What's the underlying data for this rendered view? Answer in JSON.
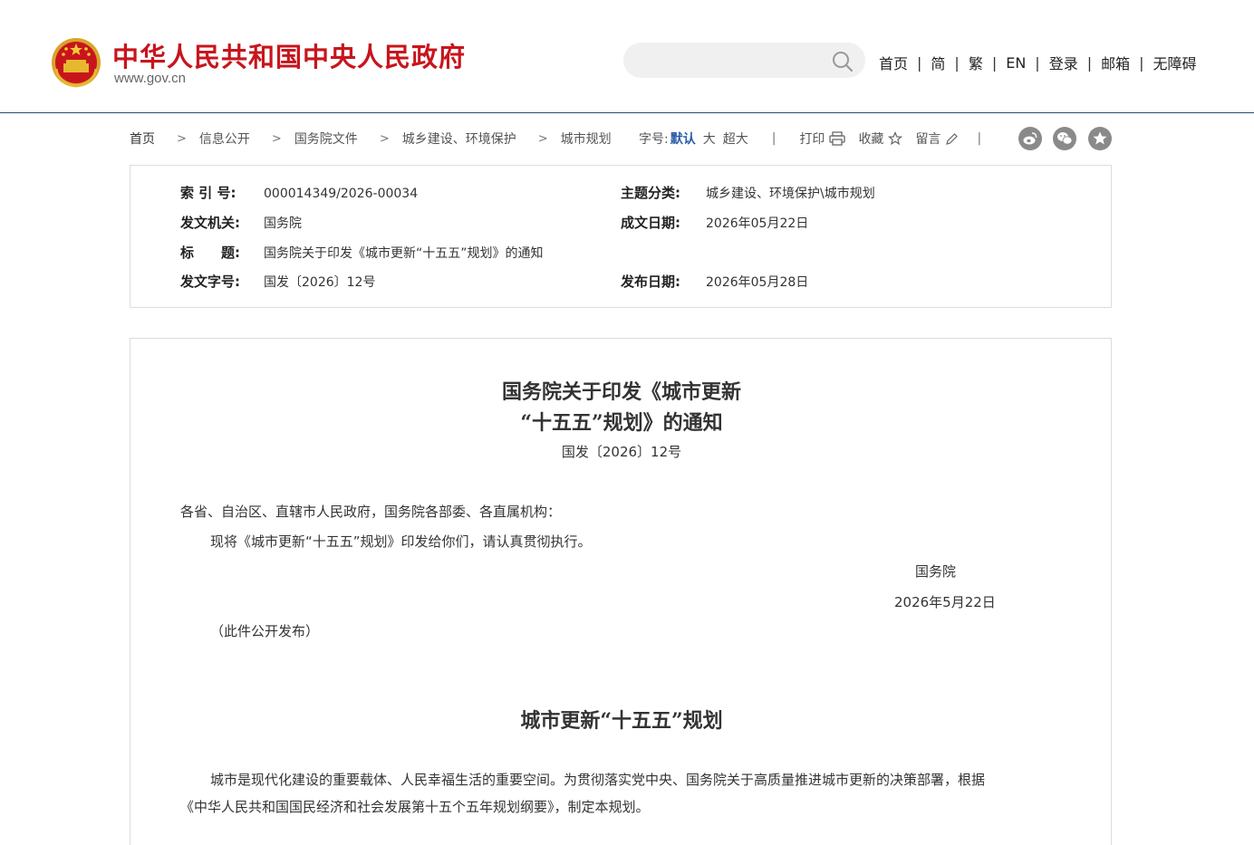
{
  "header": {
    "site_title": "中华人民共和国中央人民政府",
    "site_url": "www.gov.cn",
    "search": {
      "value": "",
      "placeholder": ""
    },
    "nav": [
      "首页",
      "简",
      "繁",
      "EN",
      "登录",
      "邮箱",
      "无障碍"
    ],
    "colors": {
      "brand_red": "#c8151d",
      "divider": "#2b4a6e"
    }
  },
  "breadcrumb": [
    "首页",
    "信息公开",
    "国务院文件",
    "城乡建设、环境保护",
    "城市规划"
  ],
  "tools": {
    "font_size_label": "字号:",
    "font_sizes": [
      "默认",
      "大",
      "超大"
    ],
    "print": "打印",
    "favorite": "收藏",
    "comment": "留言",
    "share_icons": [
      "weibo-icon",
      "wechat-icon",
      "star-icon"
    ]
  },
  "info": {
    "index_label": "索 引 号:",
    "index_value": "000014349/2026-00034",
    "topic_label": "主题分类:",
    "topic_value": "城乡建设、环境保护\\城市规划",
    "issuer_label": "发文机关:",
    "issuer_value": "国务院",
    "written_label": "成文日期:",
    "written_value": "2026年05月22日",
    "title_label": "标　　题:",
    "title_value": "国务院关于印发《城市更新“十五五”规划》的通知",
    "docno_label": "发文字号:",
    "docno_value": "国发〔2026〕12号",
    "published_label": "发布日期:",
    "published_value": "2026年05月28日"
  },
  "article": {
    "title_line1": "国务院关于印发《城市更新",
    "title_line2": "“十五五”规划》的通知",
    "docno": "国发〔2026〕12号",
    "addressee": "各省、自治区、直辖市人民政府，国务院各部委、各直属机构：",
    "body": "现将《城市更新“十五五”规划》印发给你们，请认真贯彻执行。",
    "signature": "国务院",
    "date": "2026年5月22日",
    "note": "（此件公开发布）",
    "subtitle": "城市更新“十五五”规划",
    "intro_line1": "城市是现代化建设的重要载体、人民幸福生活的重要空间。为贯彻落实党中央、国务院关于高质量推进城市更新的决策部署，根据",
    "intro_line2": "《中华人民共和国国民经济和社会发展第十五个五年规划纲要》，制定本规划。"
  }
}
